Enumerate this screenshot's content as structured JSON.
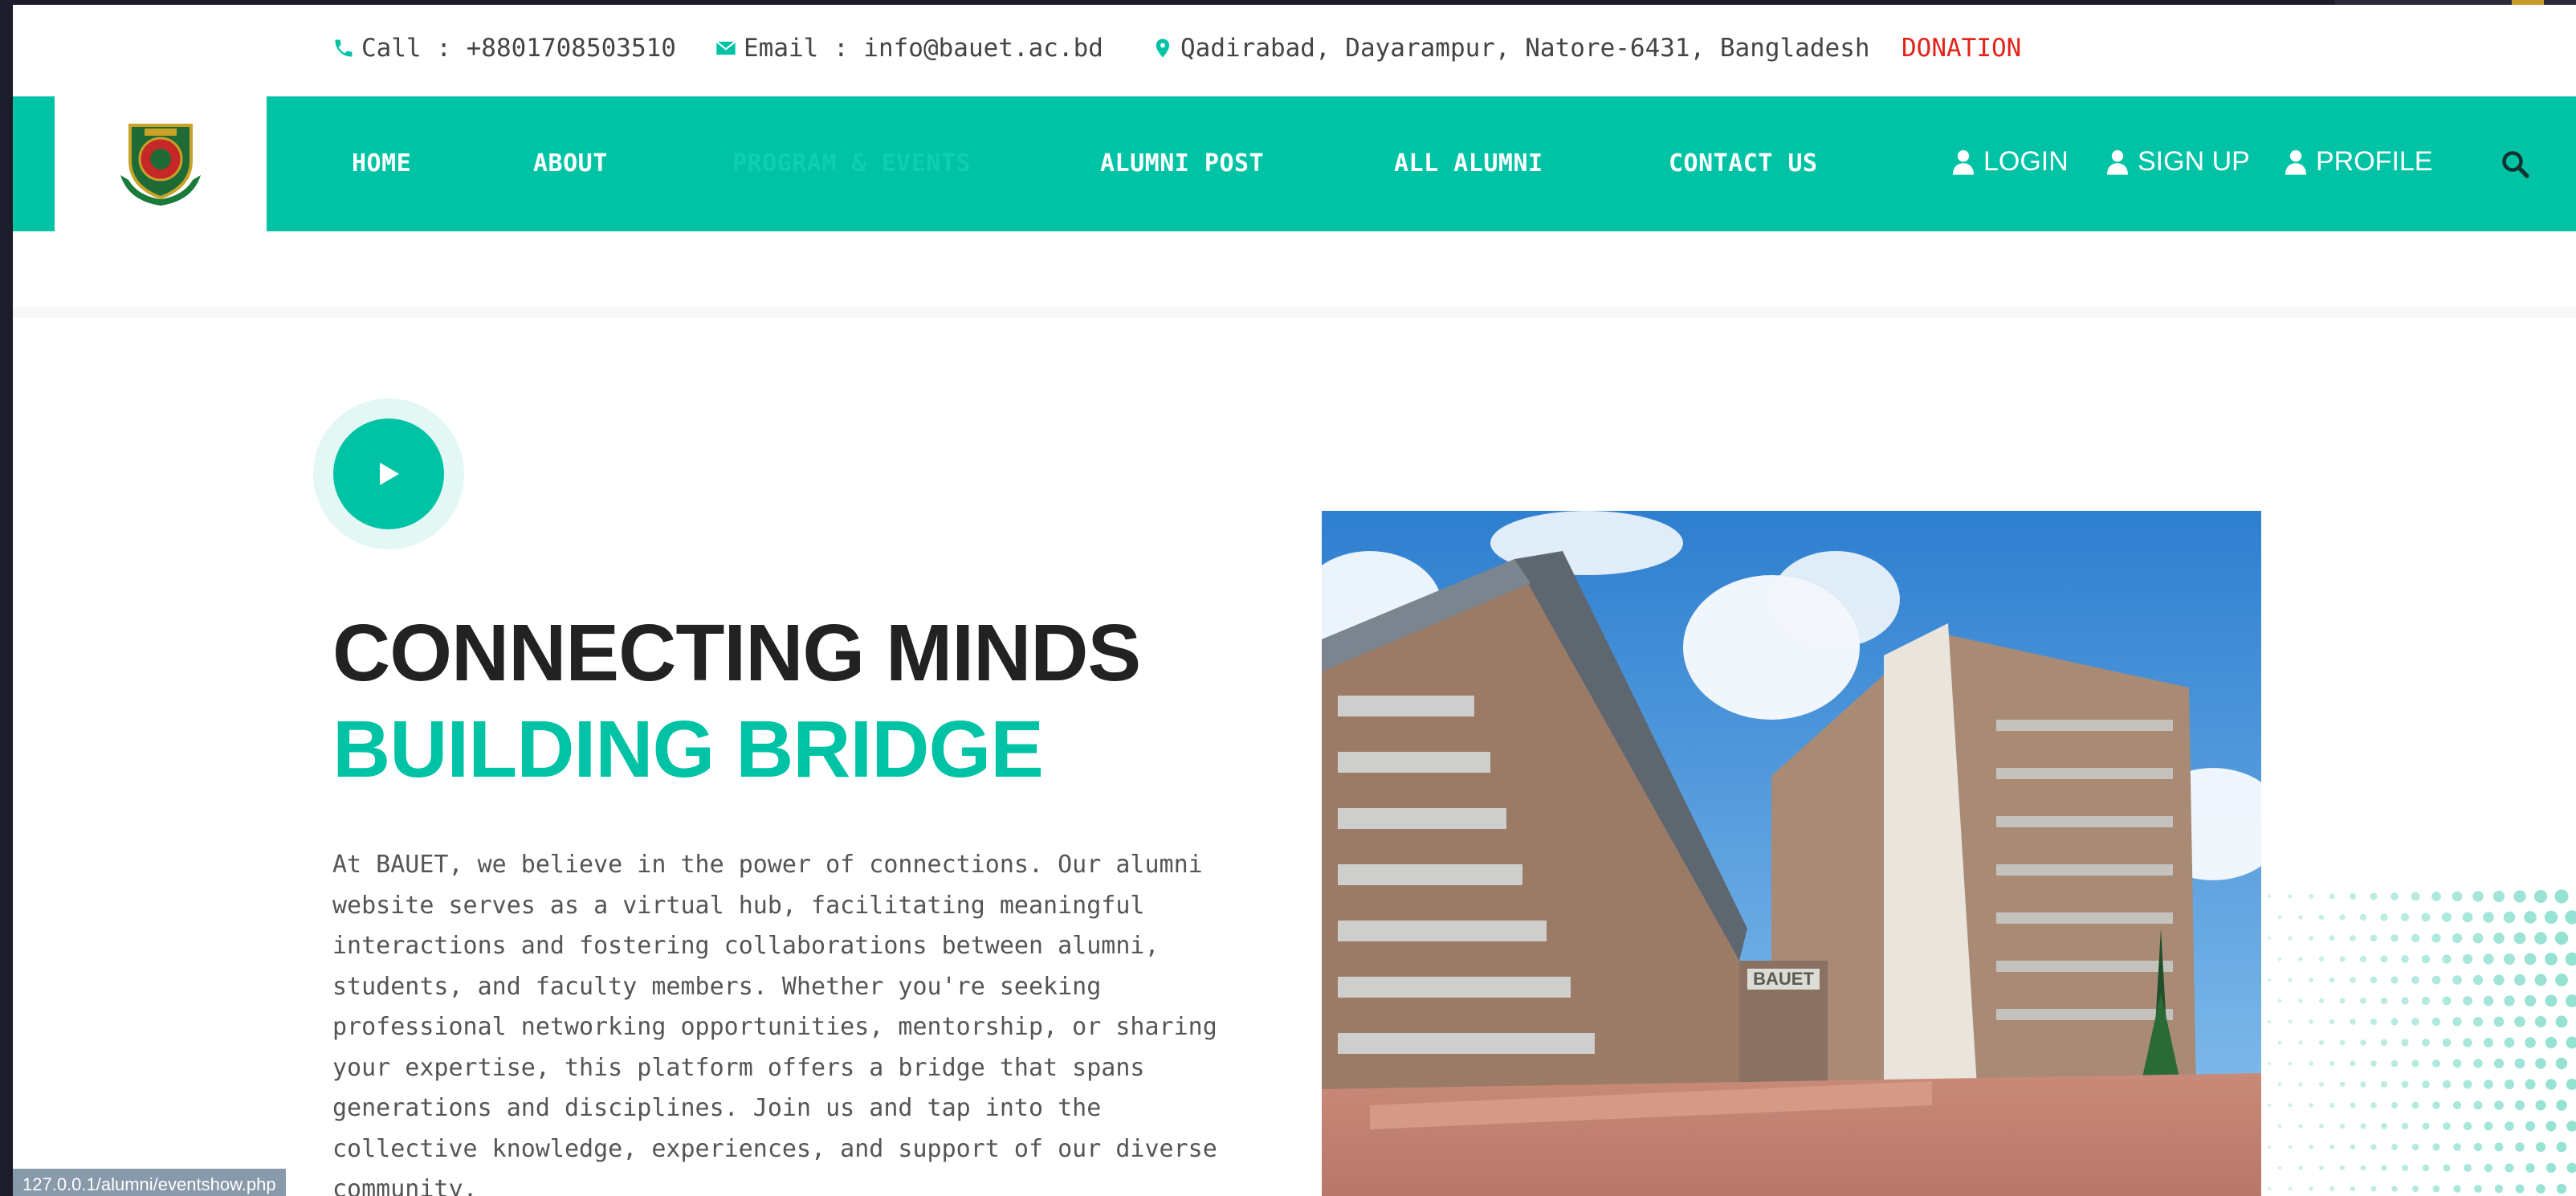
{
  "topbar": {
    "call": "Call : +8801708503510",
    "email": "Email : info@bauet.ac.bd",
    "address": "Qadirabad, Dayarampur, Natore-6431, Bangladesh",
    "donation": "DONATION"
  },
  "nav": {
    "items": [
      "HOME",
      "ABOUT",
      "PROGRAM & EVENTS",
      "ALUMNI POST",
      "ALL ALUMNI",
      "CONTACT US"
    ],
    "active": "PROGRAM & EVENTS",
    "login": "LOGIN",
    "signup": "SIGN UP",
    "profile": "PROFILE"
  },
  "hero": {
    "headline_1": "CONNECTING MINDS",
    "headline_2": "BUILDING BRIDGE",
    "intro_lines": [
      "At BAUET, we believe in the power of connections. Our alumni",
      "website serves as a virtual hub, facilitating meaningful",
      "interactions and fostering collaborations between alumni,",
      "students, and faculty members. Whether you're seeking",
      "professional networking opportunities, mentorship, or sharing",
      "your expertise, this platform offers a bridge that spans",
      "generations and disciplines. Join us and tap into the",
      "collective knowledge, experiences, and support of our diverse",
      "community."
    ],
    "photo_sign": "BAUET"
  },
  "status_url": "127.0.0.1/alumni/eventshow.php",
  "colors": {
    "accent": "#00c3a6",
    "donation": "#e2241b",
    "heading": "#222222"
  },
  "icons": [
    "phone-icon",
    "envelope-icon",
    "map-marker-icon",
    "user-icon",
    "search-icon",
    "play-icon"
  ]
}
